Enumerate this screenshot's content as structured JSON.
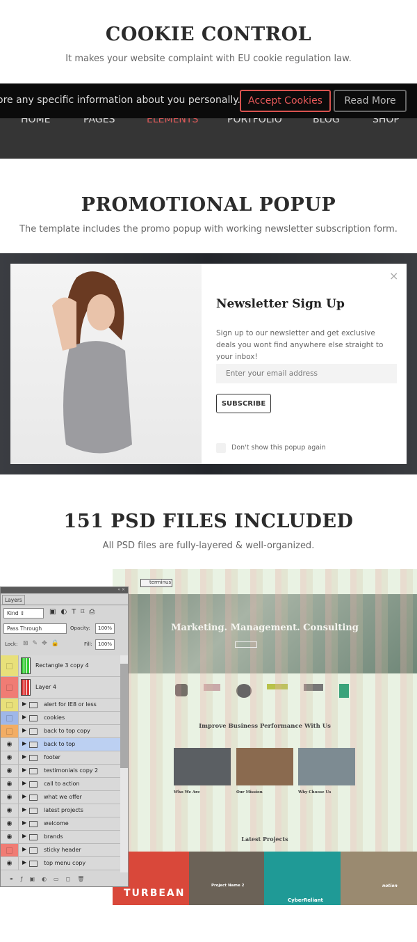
{
  "cookie_section": {
    "title": "COOKIE CONTROL",
    "subtitle": "It makes your website complaint with EU cookie regulation law.",
    "bar_text": "ore any specific information about you personally.",
    "accept_label": "Accept Cookies",
    "read_more_label": "Read More",
    "nav": [
      {
        "label": "HOME ˅"
      },
      {
        "label": "PAGES ˅"
      },
      {
        "label": "ELEMENTS ˅",
        "active": true
      },
      {
        "label": "PORTFOLIO ˅"
      },
      {
        "label": "BLOG ˅"
      },
      {
        "label": "SHOP ˅"
      }
    ],
    "accent": "#e05a5a"
  },
  "promo_section": {
    "title": "PROMOTIONAL POPUP",
    "subtitle": "The template includes the promo popup with working newsletter subscription form.",
    "popup": {
      "close": "×",
      "title": "Newsletter Sign Up",
      "description": "Sign up to our newsletter and get exclusive deals you wont find anywhere else straight to your inbox!",
      "email_placeholder": "Enter your email address",
      "subscribe_label": "SUBSCRIBE",
      "checkbox_label": "Don't show this popup again"
    }
  },
  "psd_section": {
    "title": "151 PSD FILES INCLUDED",
    "subtitle": "All PSD files are fully-layered & well-organized.",
    "mockup": {
      "logo": "terminus",
      "hero_title": "Marketing. Management. Consulting",
      "section_title": "Improve Business Performance With Us",
      "cards": [
        {
          "title": "Who We Are"
        },
        {
          "title": "Our Mission"
        },
        {
          "title": "Why Choose Us"
        }
      ],
      "projects_title": "Latest Projects",
      "projects": [
        {
          "label": "TURBEAN",
          "color": "#d9483a"
        },
        {
          "label": "Project Name 2",
          "color": "#6b6257"
        },
        {
          "label": "CyberReliant",
          "color": "#1f9a96"
        },
        {
          "label": "notion",
          "color": "#9a8a70"
        }
      ]
    },
    "layers_panel": {
      "tab": "Layers",
      "kind": "Kind",
      "blend_mode": "Pass Through",
      "opacity_label": "Opacity:",
      "opacity": "100%",
      "lock_label": "Lock:",
      "fill_label": "Fill:",
      "fill": "100%",
      "layers": [
        {
          "name": "Rectangle 3 copy 4",
          "color": "#e8e07a",
          "type": "layer"
        },
        {
          "name": "Layer 4",
          "color": "#f07c74",
          "type": "layer"
        },
        {
          "name": "alert for IE8 or less",
          "color": "#e8e07a",
          "type": "group"
        },
        {
          "name": "cookies",
          "color": "#9fb7e8",
          "type": "group"
        },
        {
          "name": "back to top copy",
          "color": "#f2ad64",
          "type": "group"
        },
        {
          "name": "back to top",
          "visible": true,
          "selected": true,
          "type": "group"
        },
        {
          "name": "footer",
          "visible": true,
          "type": "group"
        },
        {
          "name": "testimonials copy 2",
          "visible": true,
          "type": "group"
        },
        {
          "name": "call to action",
          "visible": true,
          "type": "group"
        },
        {
          "name": "what we offer",
          "visible": true,
          "type": "group"
        },
        {
          "name": "latest projects",
          "visible": true,
          "type": "group"
        },
        {
          "name": "welcome",
          "visible": true,
          "type": "group"
        },
        {
          "name": "brands",
          "visible": true,
          "type": "group"
        },
        {
          "name": "sticky header",
          "color": "#f07c74",
          "type": "group"
        },
        {
          "name": "top menu copy",
          "visible": true,
          "type": "group"
        }
      ]
    }
  }
}
